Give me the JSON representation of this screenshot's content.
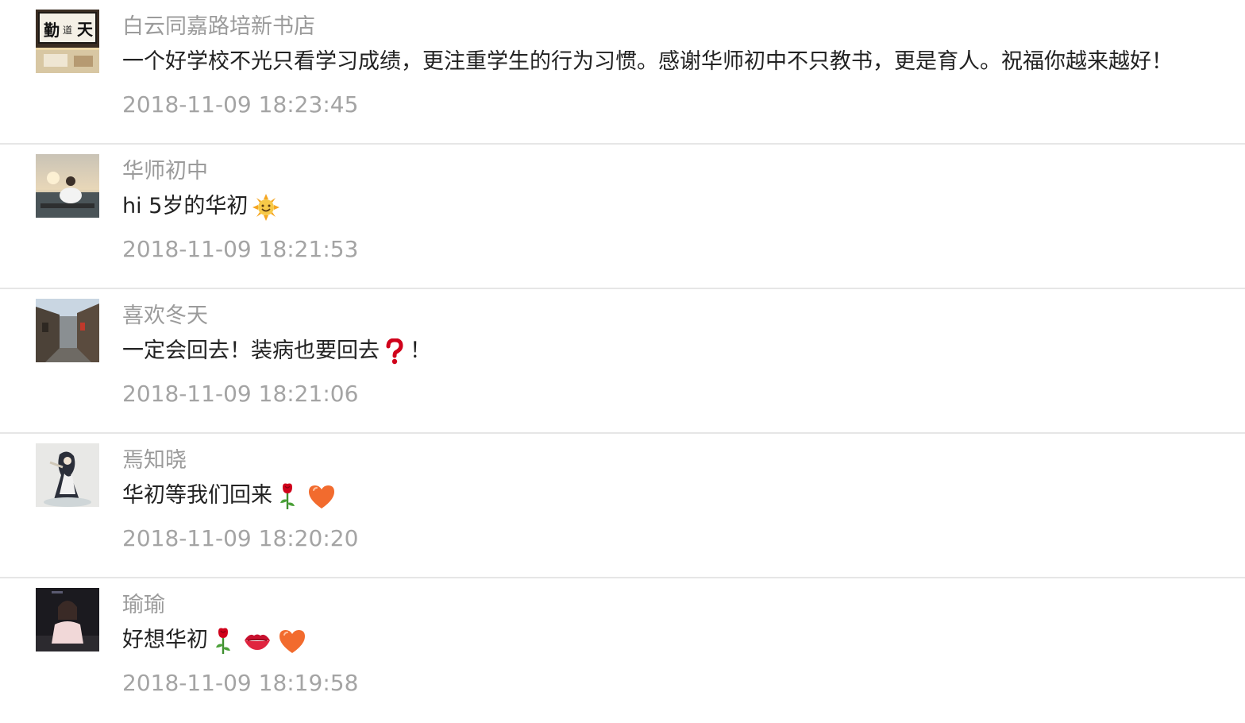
{
  "comments": [
    {
      "nickname": "白云同嘉路培新书店",
      "content": "一个好学校不光只看学习成绩，更注重学生的行为习惯。感谢华师初中不只教书，更是育人。祝福你越来越好！",
      "timestamp": "2018-11-09 18:23:45",
      "avatar": "calligraphy-avatar",
      "emojis": []
    },
    {
      "nickname": "华师初中",
      "content": "hi 5岁的华初",
      "timestamp": "2018-11-09 18:21:53",
      "avatar": "sunset-portrait-avatar",
      "emojis": [
        "sun-emoji"
      ]
    },
    {
      "nickname": "喜欢冬天",
      "content": "一定会回去！装病也要回去",
      "content_suffix": "！",
      "timestamp": "2018-11-09 18:21:06",
      "avatar": "old-street-avatar",
      "emojis": [
        "question-mark-emoji"
      ]
    },
    {
      "nickname": "焉知晓",
      "content": "华初等我们回来",
      "timestamp": "2018-11-09 18:20:20",
      "avatar": "illustrated-character-avatar",
      "emojis": [
        "rose-emoji",
        "heart-emoji"
      ]
    },
    {
      "nickname": "瑜瑜",
      "content": "好想华初",
      "timestamp": "2018-11-09 18:19:58",
      "avatar": "night-portrait-avatar",
      "emojis": [
        "rose-emoji",
        "lips-emoji",
        "heart-emoji"
      ]
    }
  ]
}
